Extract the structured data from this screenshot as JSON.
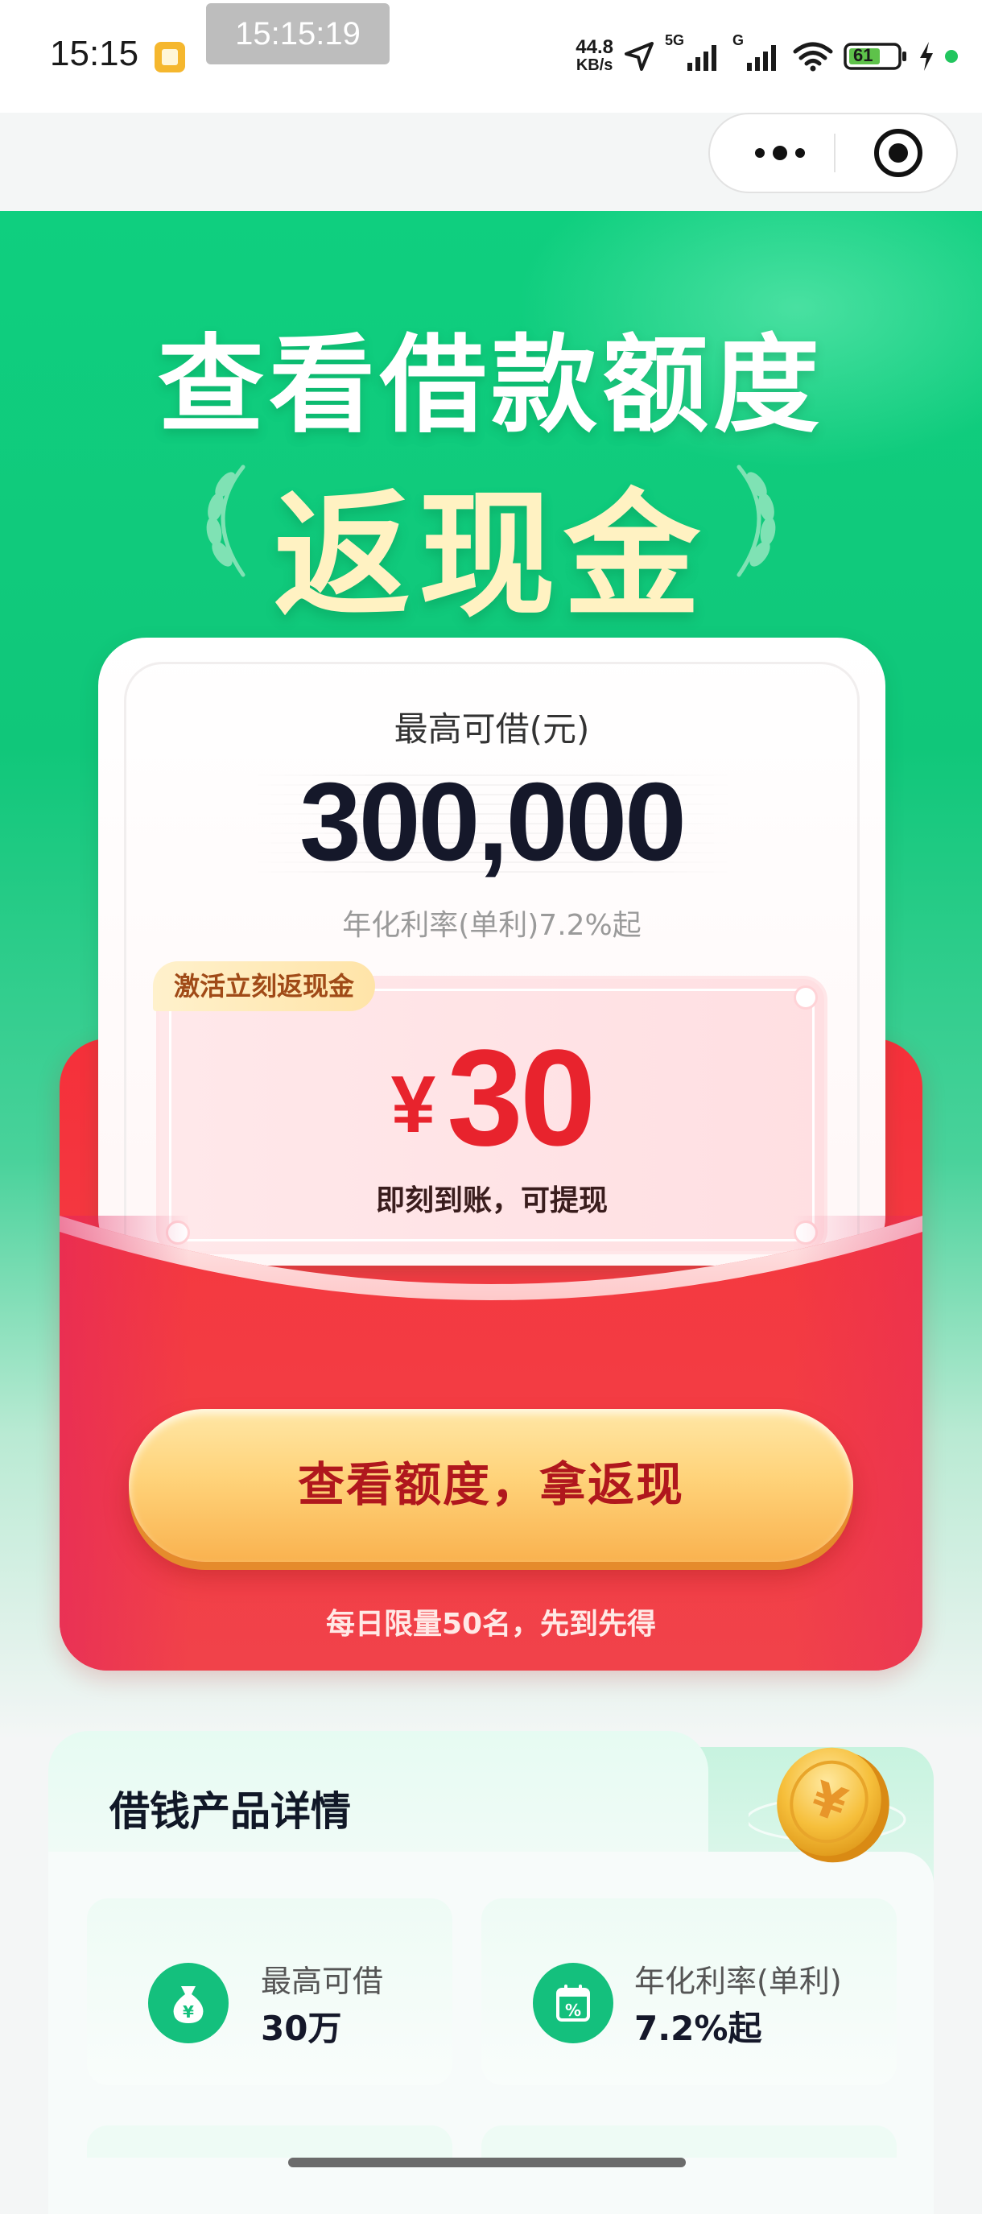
{
  "status_bar": {
    "time": "15:15",
    "more": "···",
    "screenshot_time": "15:15:19",
    "net_speed_value": "44.8",
    "net_speed_unit": "KB/s",
    "signal_1_label": "5G",
    "signal_2_label": "G",
    "battery_level": "61",
    "icons": [
      "gallery-icon",
      "navigation-arrow-icon",
      "signal-icon",
      "wifi-icon",
      "battery-icon",
      "charging-icon"
    ]
  },
  "capsule": {
    "icons": [
      "more-options-icon",
      "close-miniprogram-icon"
    ]
  },
  "hero": {
    "title": "查看借款额度",
    "subtitle": "返现金"
  },
  "card": {
    "max_label": "最高可借(元)",
    "amount": "300,000",
    "rate": "年化利率(单利)7.2%起"
  },
  "coupon": {
    "tag": "激活立刻返现金",
    "currency": "¥",
    "value": "30",
    "note": "即刻到账，可提现"
  },
  "cta": {
    "label": "查看额度，拿返现",
    "limit_note": "每日限量50名，先到先得"
  },
  "details": {
    "title": "借钱产品详情",
    "items": [
      {
        "label": "最高可借",
        "value": "30万",
        "icon": "money-bag-icon"
      },
      {
        "label": "年化利率(单利)",
        "value": "7.2%起",
        "icon": "percent-calendar-icon"
      }
    ]
  },
  "colors": {
    "hero_green": "#10c77a",
    "envelope_red": "#f33d44",
    "coupon_red": "#e8232d",
    "button_gold": "#ffd37a",
    "button_text": "#b0171d"
  }
}
